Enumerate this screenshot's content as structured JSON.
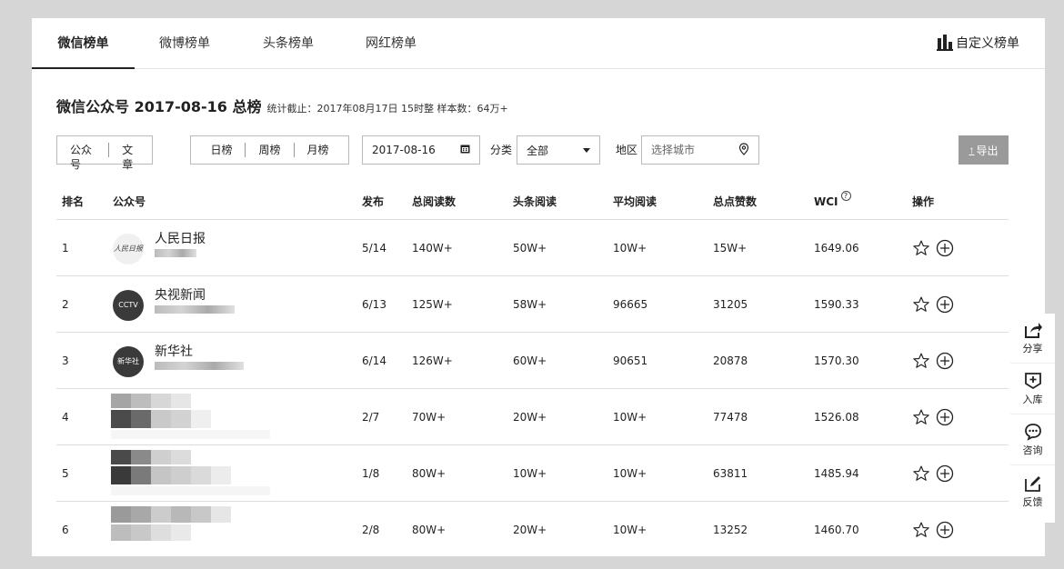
{
  "tabs": [
    {
      "label": "微信榜单",
      "active": true
    },
    {
      "label": "微博榜单",
      "active": false
    },
    {
      "label": "头条榜单",
      "active": false
    },
    {
      "label": "网红榜单",
      "active": false
    }
  ],
  "custom_rank_label": "自定义榜单",
  "title": {
    "main": "微信公众号 2017-08-16 总榜",
    "sub": "统计截止：2017年08月17日 15时整 样本数：64万+"
  },
  "filters": {
    "type": [
      "公众号",
      "文章"
    ],
    "period": [
      "日榜",
      "周榜",
      "月榜"
    ],
    "date": "2017-08-16",
    "category_label": "分类",
    "category_value": "全部",
    "region_label": "地区",
    "region_placeholder": "选择城市",
    "export_label": "导出"
  },
  "table": {
    "headers": [
      "排名",
      "公众号",
      "发布",
      "总阅读数",
      "头条阅读",
      "平均阅读",
      "总点赞数",
      "WCI",
      "操作"
    ],
    "rows": [
      {
        "rank": "1",
        "name": "人民日报",
        "avatar_text": "人民日报",
        "publish": "5/14",
        "total_read": "140W+",
        "head_read": "50W+",
        "avg_read": "10W+",
        "likes": "15W+",
        "wci": "1649.06"
      },
      {
        "rank": "2",
        "name": "央视新闻",
        "avatar_text": "CCTV",
        "publish": "6/13",
        "total_read": "125W+",
        "head_read": "58W+",
        "avg_read": "96665",
        "likes": "31205",
        "wci": "1590.33"
      },
      {
        "rank": "3",
        "name": "新华社",
        "avatar_text": "新华社",
        "publish": "6/14",
        "total_read": "126W+",
        "head_read": "60W+",
        "avg_read": "90651",
        "likes": "20878",
        "wci": "1570.30"
      },
      {
        "rank": "4",
        "name": "",
        "avatar_text": "",
        "publish": "2/7",
        "total_read": "70W+",
        "head_read": "20W+",
        "avg_read": "10W+",
        "likes": "77478",
        "wci": "1526.08"
      },
      {
        "rank": "5",
        "name": "",
        "avatar_text": "",
        "publish": "1/8",
        "total_read": "80W+",
        "head_read": "10W+",
        "avg_read": "10W+",
        "likes": "63811",
        "wci": "1485.94"
      },
      {
        "rank": "6",
        "name": "",
        "avatar_text": "",
        "publish": "2/8",
        "total_read": "80W+",
        "head_read": "20W+",
        "avg_read": "10W+",
        "likes": "13252",
        "wci": "1460.70"
      }
    ]
  },
  "side_toolbar": [
    "分享",
    "入库",
    "咨询",
    "反馈"
  ]
}
